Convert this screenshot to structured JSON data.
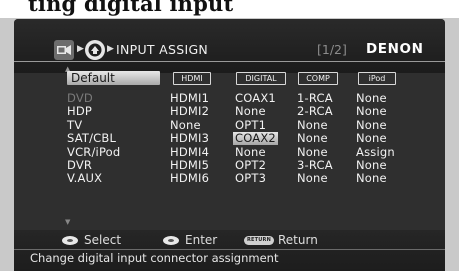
{
  "doc_heading": "ting digital input ",
  "header": {
    "icon1": "setup-menu-icon",
    "icon2": "input-setup-icon",
    "title": "INPUT ASSIGN",
    "page": "[1/2]",
    "brand": "DENON"
  },
  "default_label": "Default",
  "columns": [
    "HDMI",
    "DIGITAL",
    "COMP",
    "iPod"
  ],
  "rows": [
    {
      "name": "DVD",
      "cells": [
        "HDMI1",
        "COAX1",
        "1-RCA",
        "None"
      ],
      "disabled": true
    },
    {
      "name": "HDP",
      "cells": [
        "HDMI2",
        "None",
        "2-RCA",
        "None"
      ]
    },
    {
      "name": "TV",
      "cells": [
        "None",
        "OPT1",
        "None",
        "None"
      ]
    },
    {
      "name": "SAT/CBL",
      "cells": [
        "HDMI3",
        "COAX2",
        "None",
        "None"
      ],
      "selected_col": 1
    },
    {
      "name": "VCR/iPod",
      "cells": [
        "HDMI4",
        "None",
        "None",
        "Assign"
      ]
    },
    {
      "name": "DVR",
      "cells": [
        "HDMI5",
        "OPT2",
        "3-RCA",
        "None"
      ]
    },
    {
      "name": "V.AUX",
      "cells": [
        "HDMI6",
        "OPT3",
        "None",
        "None"
      ]
    }
  ],
  "guide": {
    "select": "Select",
    "enter": "Enter",
    "return_key": "RETURN",
    "return": "Return"
  },
  "status": "Change digital input connector assignment",
  "colors": {
    "background": "#2f2f2f",
    "highlight": "#d9d9d9",
    "dim_text": "#7a7a7a"
  }
}
